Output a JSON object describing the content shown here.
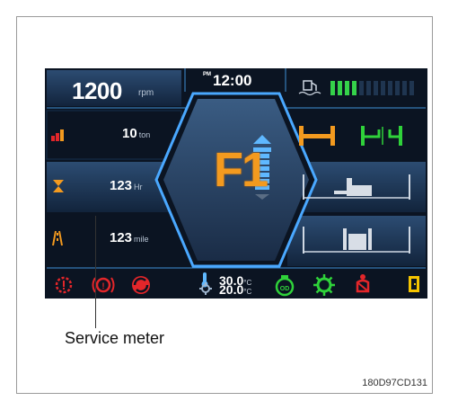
{
  "display": {
    "engine_speed": "1200",
    "engine_speed_unit": "rpm",
    "clock_ampm": "PM",
    "clock_time": "12:00",
    "load_weight": "10",
    "load_weight_unit": "ton",
    "hour_meter": "123",
    "hour_meter_unit": "Hr",
    "service_meter": "123",
    "service_meter_unit": "mile",
    "gear": "F1",
    "coolant_temp": "30.0",
    "oil_temp": "20.0",
    "temp_unit": "°C",
    "fuel_level_segments_lit": 4,
    "fuel_level_segments_total": 12
  },
  "icons": [
    "load-weight-icon",
    "hour-meter-icon",
    "service-meter-icon",
    "fuel-tank-icon",
    "forks-level-icon",
    "forks-tilt-icon",
    "lift-side-icon",
    "lift-front-icon",
    "engine-warning-icon",
    "brake-warning-icon",
    "steering-warning-icon",
    "thermometer-icon",
    "gear-oil-icon",
    "eco-mode-icon",
    "auto-gear-icon",
    "seatbelt-icon",
    "door-icon"
  ],
  "colors": {
    "accent_orange": "#f39a1f",
    "warning_red": "#e3262a",
    "ok_green": "#2fd23a",
    "panel_blue": "#1d3a5e",
    "fuel_green": "#35d24a"
  },
  "callout": {
    "label": "Service meter"
  },
  "figure_code": "180D97CD131"
}
